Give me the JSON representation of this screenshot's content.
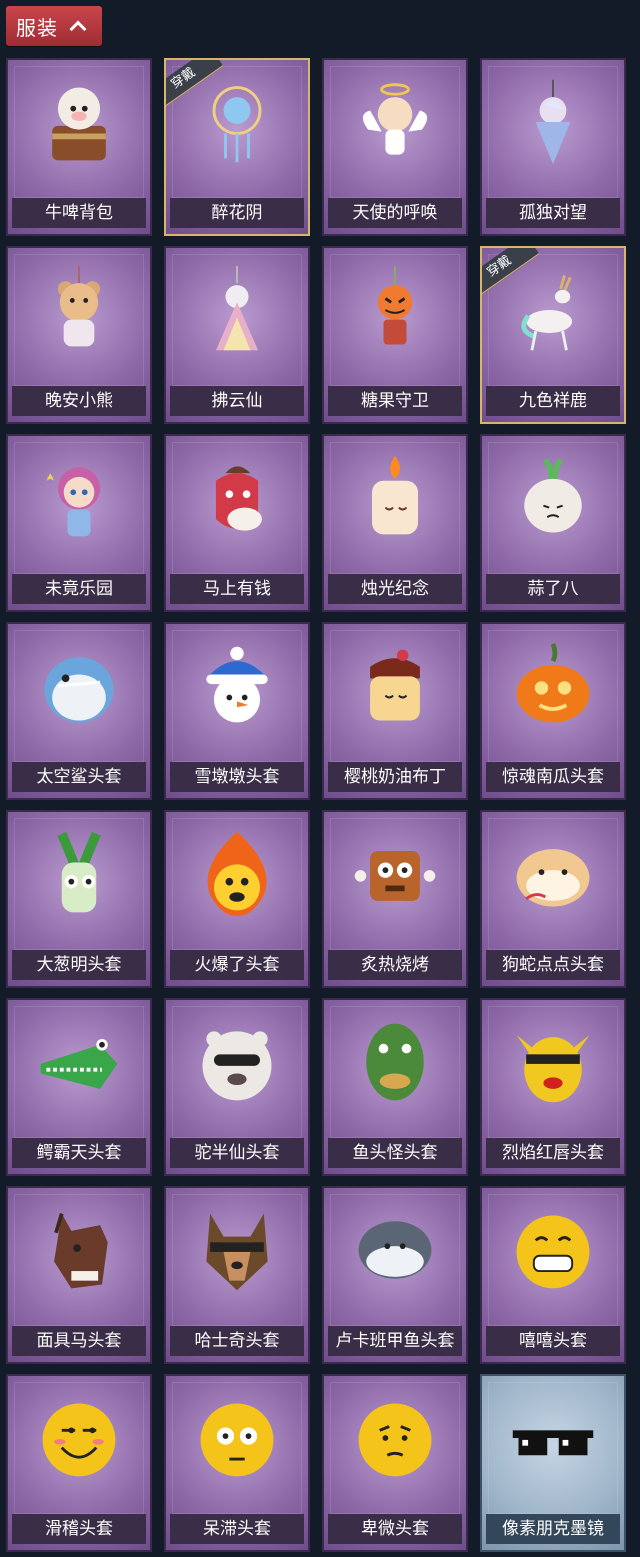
{
  "header": {
    "title": "服装"
  },
  "items": [
    {
      "name": "牛啤背包",
      "equipped": false,
      "equip_badge": "",
      "icon": "cow-beer-backpack-icon",
      "style": "purple"
    },
    {
      "name": "醉花阴",
      "equipped": true,
      "equip_badge": "穿戴",
      "icon": "flower-dreamcatcher-icon",
      "style": "purple"
    },
    {
      "name": "天使的呼唤",
      "equipped": false,
      "equip_badge": "",
      "icon": "angel-charm-icon",
      "style": "purple"
    },
    {
      "name": "孤独对望",
      "equipped": false,
      "equip_badge": "",
      "icon": "lonely-gaze-charm-icon",
      "style": "purple"
    },
    {
      "name": "晚安小熊",
      "equipped": false,
      "equip_badge": "",
      "icon": "bear-charm-icon",
      "style": "purple"
    },
    {
      "name": "拂云仙",
      "equipped": false,
      "equip_badge": "",
      "icon": "cloud-fairy-charm-icon",
      "style": "purple"
    },
    {
      "name": "糖果守卫",
      "equipped": false,
      "equip_badge": "",
      "icon": "candy-guard-charm-icon",
      "style": "purple"
    },
    {
      "name": "九色祥鹿",
      "equipped": true,
      "equip_badge": "穿戴",
      "icon": "deer-charm-icon",
      "style": "purple"
    },
    {
      "name": "未竟乐园",
      "equipped": false,
      "equip_badge": "",
      "icon": "doll-charm-icon",
      "style": "purple"
    },
    {
      "name": "马上有钱",
      "equipped": false,
      "equip_badge": "",
      "icon": "horse-head-icon",
      "style": "purple"
    },
    {
      "name": "烛光纪念",
      "equipped": false,
      "equip_badge": "",
      "icon": "candle-icon",
      "style": "purple"
    },
    {
      "name": "蒜了八",
      "equipped": false,
      "equip_badge": "",
      "icon": "garlic-icon",
      "style": "purple"
    },
    {
      "name": "太空鲨头套",
      "equipped": false,
      "equip_badge": "",
      "icon": "shark-mask-icon",
      "style": "purple"
    },
    {
      "name": "雪墩墩头套",
      "equipped": false,
      "equip_badge": "",
      "icon": "snowman-mask-icon",
      "style": "purple"
    },
    {
      "name": "樱桃奶油布丁",
      "equipped": false,
      "equip_badge": "",
      "icon": "pudding-mask-icon",
      "style": "purple"
    },
    {
      "name": "惊魂南瓜头套",
      "equipped": false,
      "equip_badge": "",
      "icon": "pumpkin-mask-icon",
      "style": "purple"
    },
    {
      "name": "大葱明头套",
      "equipped": false,
      "equip_badge": "",
      "icon": "scallion-mask-icon",
      "style": "purple"
    },
    {
      "name": "火爆了头套",
      "equipped": false,
      "equip_badge": "",
      "icon": "fire-mask-icon",
      "style": "purple"
    },
    {
      "name": "炙热烧烤",
      "equipped": false,
      "equip_badge": "",
      "icon": "bbq-mask-icon",
      "style": "purple"
    },
    {
      "name": "狗蛇点点头套",
      "equipped": false,
      "equip_badge": "",
      "icon": "dog-snake-mask-icon",
      "style": "purple"
    },
    {
      "name": "鳄霸天头套",
      "equipped": false,
      "equip_badge": "",
      "icon": "crocodile-mask-icon",
      "style": "purple"
    },
    {
      "name": "驼半仙头套",
      "equipped": false,
      "equip_badge": "",
      "icon": "alpaca-mask-icon",
      "style": "purple"
    },
    {
      "name": "鱼头怪头套",
      "equipped": false,
      "equip_badge": "",
      "icon": "fish-head-mask-icon",
      "style": "purple"
    },
    {
      "name": "烈焰红唇头套",
      "equipped": false,
      "equip_badge": "",
      "icon": "pikachu-lips-mask-icon",
      "style": "purple"
    },
    {
      "name": "面具马头套",
      "equipped": false,
      "equip_badge": "",
      "icon": "horse-mask-icon",
      "style": "purple"
    },
    {
      "name": "哈士奇头套",
      "equipped": false,
      "equip_badge": "",
      "icon": "husky-mask-icon",
      "style": "purple"
    },
    {
      "name": "卢卡班甲鱼头套",
      "equipped": false,
      "equip_badge": "",
      "icon": "fish-mask-icon",
      "style": "purple"
    },
    {
      "name": "嘻嘻头套",
      "equipped": false,
      "equip_badge": "",
      "icon": "grin-emoji-mask-icon",
      "style": "purple"
    },
    {
      "name": "滑稽头套",
      "equipped": false,
      "equip_badge": "",
      "icon": "funny-emoji-mask-icon",
      "style": "purple"
    },
    {
      "name": "呆滞头套",
      "equipped": false,
      "equip_badge": "",
      "icon": "stunned-emoji-mask-icon",
      "style": "purple"
    },
    {
      "name": "卑微头套",
      "equipped": false,
      "equip_badge": "",
      "icon": "humble-emoji-mask-icon",
      "style": "purple"
    },
    {
      "name": "像素朋克墨镜",
      "equipped": false,
      "equip_badge": "",
      "icon": "pixel-sunglasses-icon",
      "style": "blue"
    }
  ]
}
